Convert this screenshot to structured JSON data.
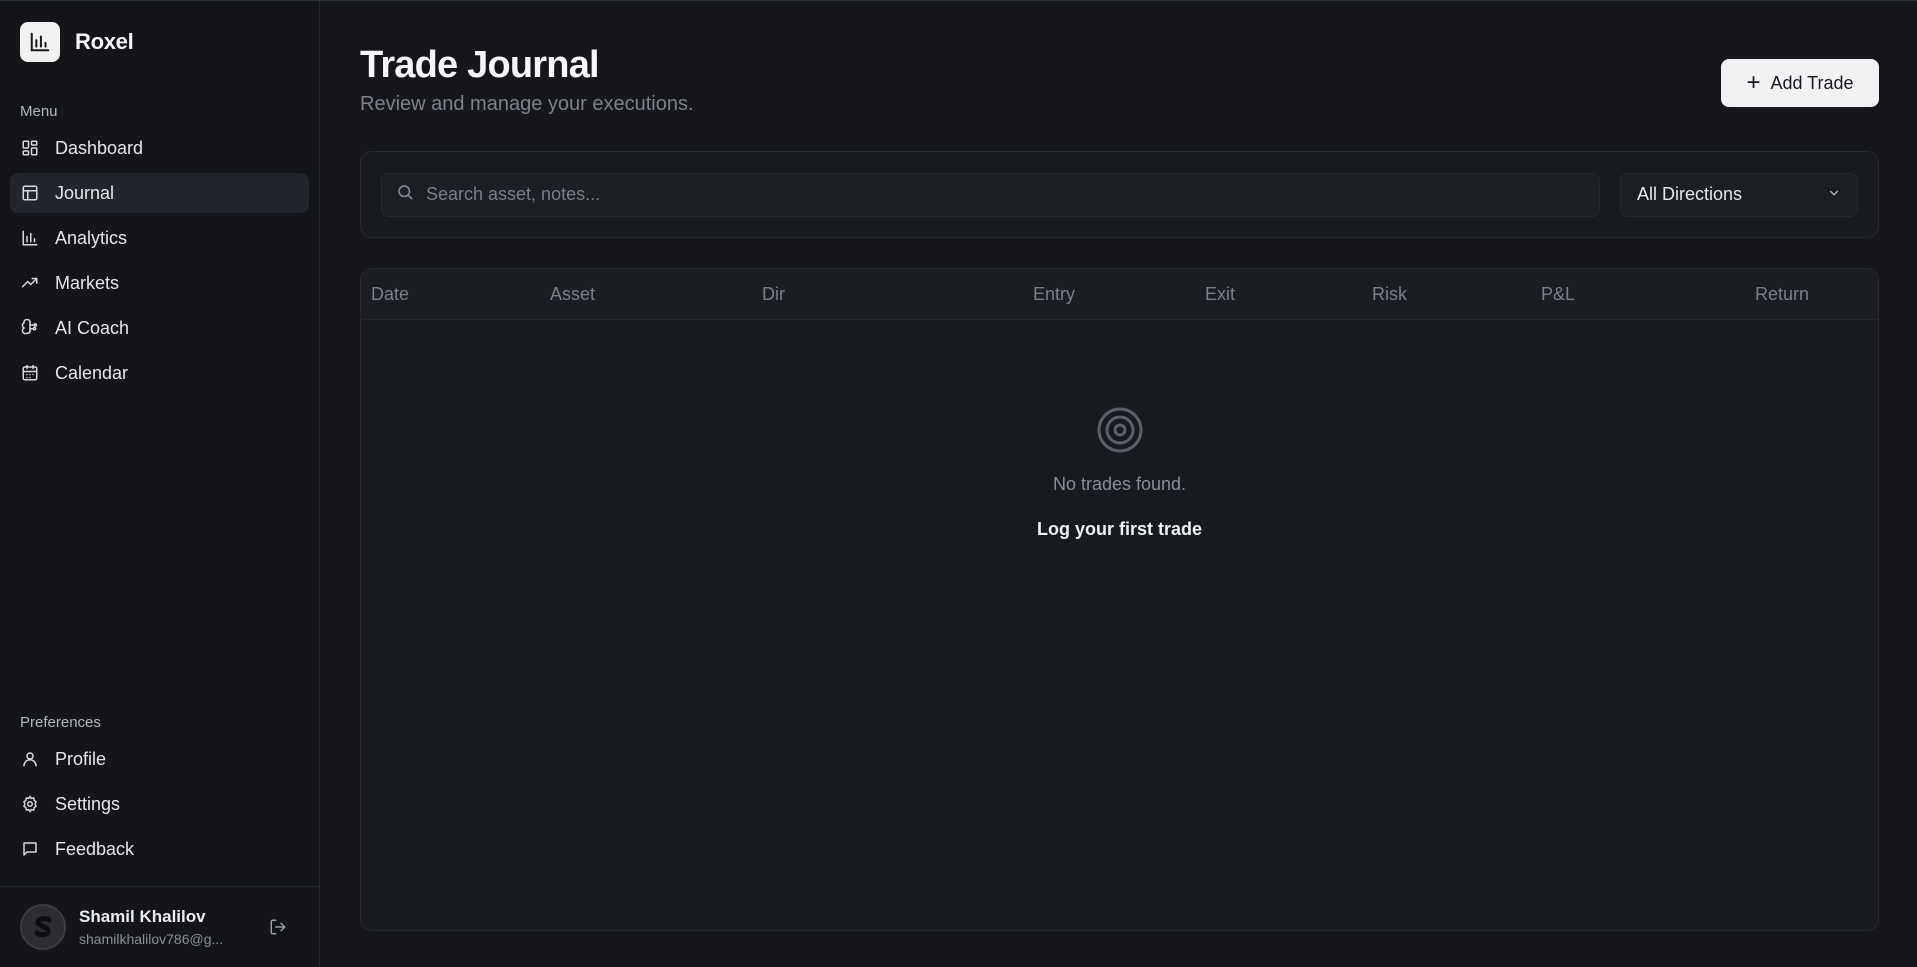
{
  "brand": {
    "name": "Roxel",
    "logo_icon": "bar-chart-icon"
  },
  "sidebar": {
    "menu_label": "Menu",
    "items": [
      {
        "label": "Dashboard",
        "icon": "layout-grid-icon",
        "active": false
      },
      {
        "label": "Journal",
        "icon": "table-icon",
        "active": true
      },
      {
        "label": "Analytics",
        "icon": "bar-chart-icon",
        "active": false
      },
      {
        "label": "Markets",
        "icon": "trending-up-icon",
        "active": false
      },
      {
        "label": "AI Coach",
        "icon": "brain-icon",
        "active": false
      },
      {
        "label": "Calendar",
        "icon": "calendar-icon",
        "active": false
      }
    ],
    "preferences_label": "Preferences",
    "preferences": [
      {
        "label": "Profile",
        "icon": "user-icon"
      },
      {
        "label": "Settings",
        "icon": "gear-icon"
      },
      {
        "label": "Feedback",
        "icon": "message-square-icon"
      }
    ]
  },
  "user": {
    "name": "Shamil Khalilov",
    "email": "shamilkhalilov786@g..."
  },
  "header": {
    "title": "Trade Journal",
    "subtitle": "Review and manage your executions.",
    "add_button": "Add Trade"
  },
  "filters": {
    "search_placeholder": "Search asset, notes...",
    "direction_selected": "All Directions"
  },
  "table": {
    "columns": [
      "Date",
      "Asset",
      "Dir",
      "Entry",
      "Exit",
      "Risk",
      "P&L",
      "Return"
    ],
    "empty_text": "No trades found.",
    "empty_action": "Log your first trade"
  },
  "colors": {
    "background": "#15171b",
    "sidebar": "#131518",
    "accent_button": "#f1f2f3",
    "active_nav": "#22252b"
  }
}
